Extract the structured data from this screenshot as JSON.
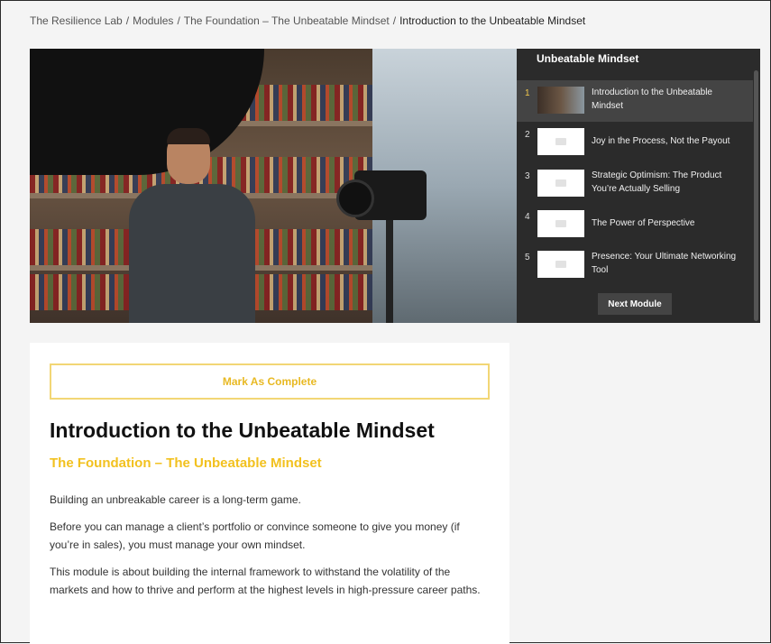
{
  "breadcrumb": {
    "items": [
      "The Resilience Lab",
      "Modules",
      "The Foundation – The Unbeatable Mindset"
    ],
    "current": "Introduction to the Unbeatable Mindset",
    "separator": "/"
  },
  "playlist": {
    "title": "Unbeatable Mindset",
    "items": [
      {
        "number": "1",
        "label": "Introduction to the Unbeatable Mindset",
        "active": true
      },
      {
        "number": "2",
        "label": "Joy in the Process, Not the Payout",
        "active": false
      },
      {
        "number": "3",
        "label": "Strategic Optimism: The Product You’re Actually Selling",
        "active": false
      },
      {
        "number": "4",
        "label": "The Power of Perspective",
        "active": false
      },
      {
        "number": "5",
        "label": "Presence: Your Ultimate Networking Tool",
        "active": false
      }
    ],
    "next_button": "Next Module"
  },
  "lesson": {
    "mark_complete": "Mark As Complete",
    "title": "Introduction to the Unbeatable Mindset",
    "module": "The Foundation – The Unbeatable Mindset",
    "paragraphs": [
      "Building an unbreakable career is a long-term game.",
      "Before you can manage a client’s portfolio or convince someone to give you money (if you’re in sales), you must manage your own mindset.",
      "This module is about building the internal framework to withstand the volatility of the markets and how to thrive and perform at the highest levels in high-pressure career paths."
    ]
  },
  "colors": {
    "accent": "#f2c11f",
    "playlist_bg": "#2b2b2b",
    "active_item": "#444444"
  }
}
